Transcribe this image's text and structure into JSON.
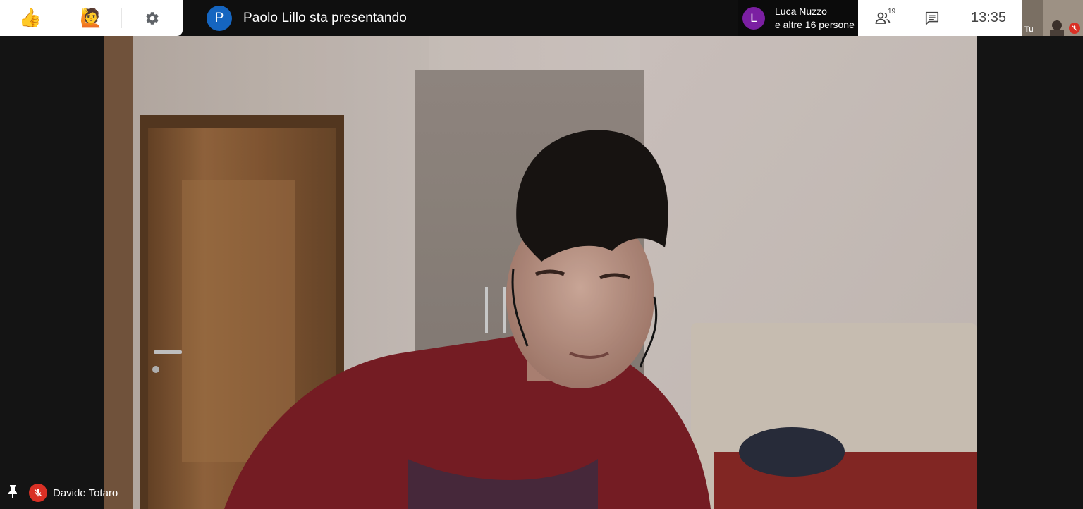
{
  "reactions": {
    "items": [
      {
        "icon": "thumbs-up-icon",
        "glyph": "👍"
      },
      {
        "icon": "raise-hand-person-icon",
        "glyph": "🙋"
      },
      {
        "icon": "gear-icon"
      }
    ]
  },
  "presenter": {
    "avatar_letter": "P",
    "text": "Paolo Lillo sta presentando"
  },
  "participants_chip": {
    "avatar_letter": "L",
    "line1": "Luca Nuzzo",
    "line2": "e altre 16 persone"
  },
  "toolbar": {
    "people_count": "19",
    "people_icon": "people-icon",
    "chat_icon": "chat-icon",
    "time": "13:35"
  },
  "self_view": {
    "label": "Tu",
    "mic_icon": "mic-off-icon"
  },
  "main_video": {
    "participant_name": "Davide Totaro",
    "pin_icon": "pin-icon",
    "mic_icon": "mic-off-icon"
  },
  "colors": {
    "presenter_avatar": "#1565c0",
    "participant_avatar": "#7b1fa2",
    "mic_off_red": "#d93025",
    "topbar_bg": "#0f0f0f"
  }
}
